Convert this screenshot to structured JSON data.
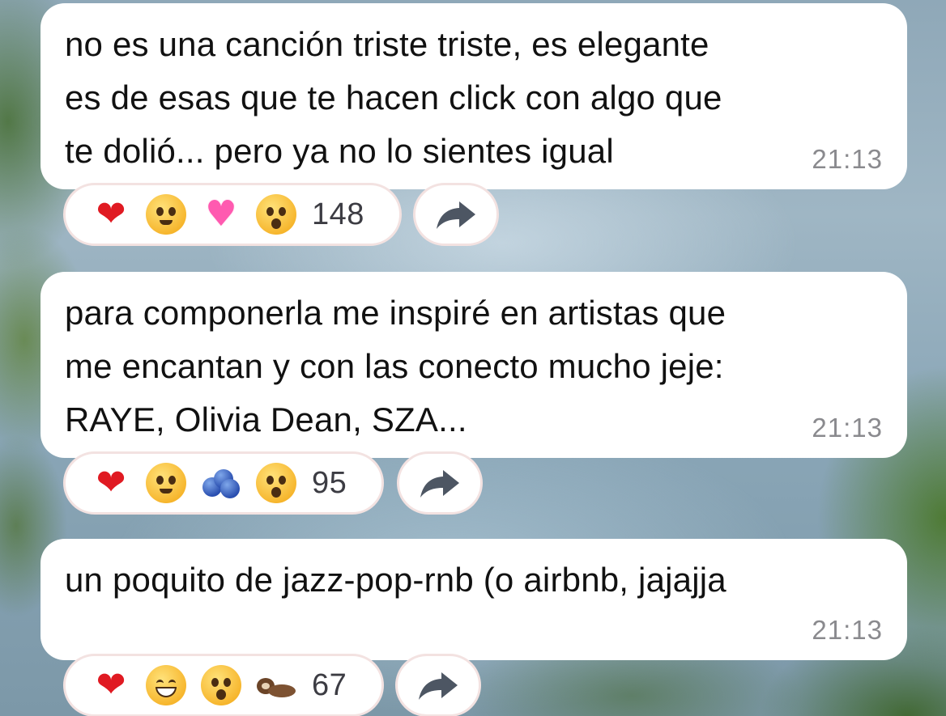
{
  "messages": [
    {
      "text": "no es una canción triste triste, es elegante\nes de esas que te hacen click con algo que\nte dolió... pero ya no lo sientes igual",
      "time": "21:13",
      "reactions": [
        "red-heart",
        "pleading-face",
        "sparkling-heart",
        "astonished-face"
      ],
      "count": "148"
    },
    {
      "text": "para componerla me inspiré en artistas que\nme encantan y con las conecto mucho jeje:\nRAYE, Olivia Dean, SZA...",
      "time": "21:13",
      "reactions": [
        "red-heart",
        "pleading-face",
        "blueberries",
        "astonished-face"
      ],
      "count": "95"
    },
    {
      "text": "un poquito de jazz-pop-rnb (o airbnb, jajajja",
      "time": "21:13",
      "reactions": [
        "red-heart",
        "tears-of-joy-face",
        "astonished-face",
        "otter"
      ],
      "count": "67"
    }
  ],
  "share_icon": "forward-arrow-icon",
  "colors": {
    "bubble": "#ffffff",
    "text": "#111111",
    "time": "#8a8a8e",
    "heart": "#e01a22",
    "share_icon": "#4d5663"
  }
}
